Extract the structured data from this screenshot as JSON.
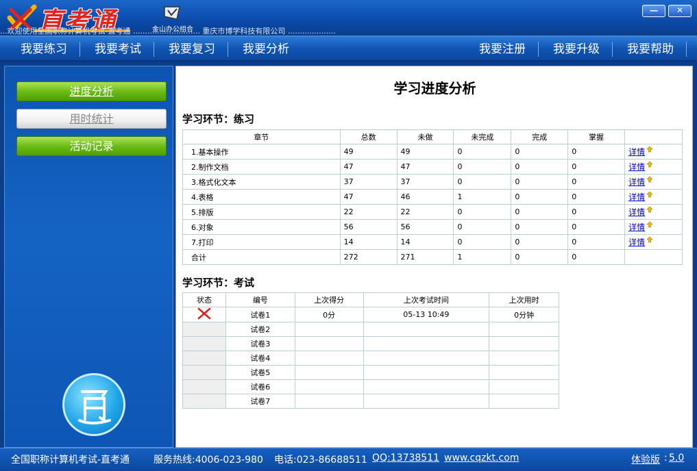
{
  "app": {
    "logo_text": "直考通",
    "kingsoft_label": "金山办公组合",
    "marquee": "...欢迎使用全国职称计算机考试-直考通 ............................ 重庆市博学科技有限公司 ...................."
  },
  "menubar": {
    "left": [
      "我要练习",
      "我要考试",
      "我要复习",
      "我要分析"
    ],
    "right": [
      "我要注册",
      "我要升级",
      "我要帮助"
    ]
  },
  "sidebar": {
    "items": [
      {
        "label": "进度分析"
      },
      {
        "label": "用时统计"
      },
      {
        "label": "活动记录"
      }
    ]
  },
  "content": {
    "title": "学习进度分析",
    "practice": {
      "section_title": "学习环节：练习",
      "headers": [
        "章节",
        "总数",
        "未做",
        "未完成",
        "完成",
        "掌握",
        ""
      ],
      "rows": [
        {
          "chapter": "1.基本操作",
          "total": "49",
          "undone": "49",
          "incomplete": "0",
          "done": "0",
          "mastered": "0",
          "link": "详情"
        },
        {
          "chapter": "2.制作文档",
          "total": "47",
          "undone": "47",
          "incomplete": "0",
          "done": "0",
          "mastered": "0",
          "link": "详情"
        },
        {
          "chapter": "3.格式化文本",
          "total": "37",
          "undone": "37",
          "incomplete": "0",
          "done": "0",
          "mastered": "0",
          "link": "详情"
        },
        {
          "chapter": "4.表格",
          "total": "47",
          "undone": "46",
          "incomplete": "1",
          "done": "0",
          "mastered": "0",
          "link": "详情"
        },
        {
          "chapter": "5.排版",
          "total": "22",
          "undone": "22",
          "incomplete": "0",
          "done": "0",
          "mastered": "0",
          "link": "详情"
        },
        {
          "chapter": "6.对象",
          "total": "56",
          "undone": "56",
          "incomplete": "0",
          "done": "0",
          "mastered": "0",
          "link": "详情"
        },
        {
          "chapter": "7.打印",
          "total": "14",
          "undone": "14",
          "incomplete": "0",
          "done": "0",
          "mastered": "0",
          "link": "详情"
        }
      ],
      "total_row": {
        "chapter": "合计",
        "total": "272",
        "undone": "271",
        "incomplete": "1",
        "done": "0",
        "mastered": "0"
      }
    },
    "exam": {
      "section_title": "学习环节：考试",
      "headers": [
        "状态",
        "编号",
        "上次得分",
        "上次考试时间",
        "上次用时"
      ],
      "rows": [
        {
          "status": "fail",
          "id": "试卷1",
          "score": "0分",
          "time": "05-13 10:49",
          "duration": "0分钟"
        },
        {
          "status": "",
          "id": "试卷2",
          "score": "",
          "time": "",
          "duration": ""
        },
        {
          "status": "",
          "id": "试卷3",
          "score": "",
          "time": "",
          "duration": ""
        },
        {
          "status": "",
          "id": "试卷4",
          "score": "",
          "time": "",
          "duration": ""
        },
        {
          "status": "",
          "id": "试卷5",
          "score": "",
          "time": "",
          "duration": ""
        },
        {
          "status": "",
          "id": "试卷6",
          "score": "",
          "time": "",
          "duration": ""
        },
        {
          "status": "",
          "id": "试卷7",
          "score": "",
          "time": "",
          "duration": ""
        }
      ]
    }
  },
  "statusbar": {
    "product": "全国职称计算机考试-直考通",
    "hotline": "服务热线:4006-023-980",
    "phone": "电话:023-86688511",
    "qq": "QQ:13738511",
    "website": "www.cqzkt.com",
    "version_label": "体验版",
    "version_sep": ":",
    "version": "5.0"
  },
  "colors": {
    "brand_red": "#e0241f",
    "frame_blue": "#0a3f8c",
    "button_green": "#6bbc16",
    "link_blue": "#0000cc"
  }
}
